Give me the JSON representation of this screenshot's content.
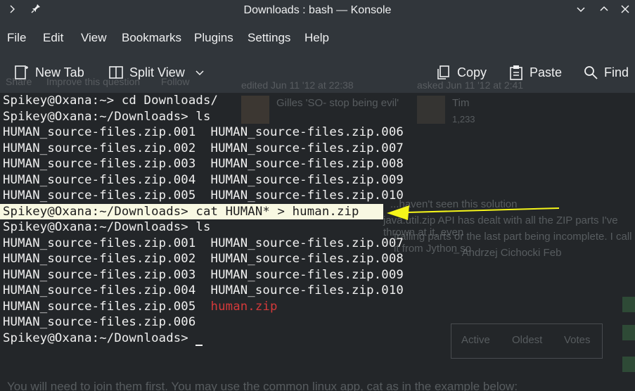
{
  "window": {
    "title": "Downloads : bash — Konsole",
    "left_icons": [
      "chevron-right-icon",
      "pin-icon"
    ],
    "right_icons": [
      "minimize-icon",
      "maximize-icon",
      "close-icon"
    ]
  },
  "menubar": [
    "File",
    "Edit",
    "View",
    "Bookmarks",
    "Plugins",
    "Settings",
    "Help"
  ],
  "toolbar": {
    "new_tab": "New Tab",
    "split_view": "Split View",
    "copy": "Copy",
    "paste": "Paste",
    "find": "Find"
  },
  "terminal_lines": [
    "Spikey@Oxana:~> cd Downloads/",
    "Spikey@Oxana:~/Downloads> ls",
    "HUMAN_source-files.zip.001  HUMAN_source-files.zip.006",
    "HUMAN_source-files.zip.002  HUMAN_source-files.zip.007",
    "HUMAN_source-files.zip.003  HUMAN_source-files.zip.008",
    "HUMAN_source-files.zip.004  HUMAN_source-files.zip.009",
    "HUMAN_source-files.zip.005  HUMAN_source-files.zip.010",
    "Spikey@Oxana:~/Downloads> cat HUMAN* > human.zip",
    "Spikey@Oxana:~/Downloads> ls",
    "HUMAN_source-files.zip.001  HUMAN_source-files.zip.007",
    "HUMAN_source-files.zip.002  HUMAN_source-files.zip.008",
    "HUMAN_source-files.zip.003  HUMAN_source-files.zip.009",
    "HUMAN_source-files.zip.004  HUMAN_source-files.zip.010",
    "HUMAN_source-files.zip.005  ",
    "HUMAN_source-files.zip.006",
    "Spikey@Oxana:~/Downloads> "
  ],
  "highlighted_new_file": "human.zip",
  "annotation": {
    "arrow_color": "#f5f51a",
    "highlight_color": "#f8f8e2"
  },
  "background_page": {
    "share": "Share",
    "improve": "Improve this question",
    "follow": "Follow",
    "edited": "edited Jun 11 '12 at 22:38",
    "asked": "asked Jun 11 '12 at 2:41",
    "editor": "Gilles 'SO- stop being evil'",
    "asker": "Tim",
    "asker_rep": "1,233",
    "comment1": "...haven't seen this solution",
    "comment2": "java.util.zip API has dealt with all the ZIP parts I've thrown at it, even",
    "comment3": "trailing parts or the last part being incomplete. I call it from Jython so",
    "comment4": "– Andrzej Cichocki Feb",
    "sort_tabs": [
      "Active",
      "Oldest",
      "Votes"
    ],
    "answer_text": "You will need to join them first. You may use the common linux app, cat as in the example below:"
  }
}
